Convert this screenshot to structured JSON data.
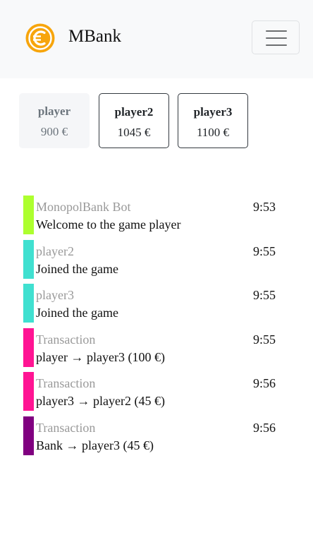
{
  "header": {
    "brand_name": "MBank",
    "logo_icon": "euro-coin-icon",
    "menu_icon": "hamburger-icon",
    "logo_color": "#f7a50c"
  },
  "players": [
    {
      "name": "player",
      "balance": "900 €",
      "current": true
    },
    {
      "name": "player2",
      "balance": "1045 €",
      "current": false
    },
    {
      "name": "player3",
      "balance": "1100 €",
      "current": false
    }
  ],
  "messages": [
    {
      "sender": "MonopolBank Bot",
      "text": "Welcome to the game player",
      "time": "9:53",
      "color": "#adff2f"
    },
    {
      "sender": "player2",
      "text": "Joined the game",
      "time": "9:55",
      "color": "#40e0d0"
    },
    {
      "sender": "player3",
      "text": "Joined the game",
      "time": "9:55",
      "color": "#40e0d0"
    },
    {
      "sender": "Transaction",
      "text": "player → player3 (100 €)",
      "time": "9:55",
      "color": "#ff1493"
    },
    {
      "sender": "Transaction",
      "text": "player3 → player2 (45 €)",
      "time": "9:56",
      "color": "#ff1493"
    },
    {
      "sender": "Transaction",
      "text": "Bank → player3 (45 €)",
      "time": "9:56",
      "color": "#800080"
    }
  ]
}
